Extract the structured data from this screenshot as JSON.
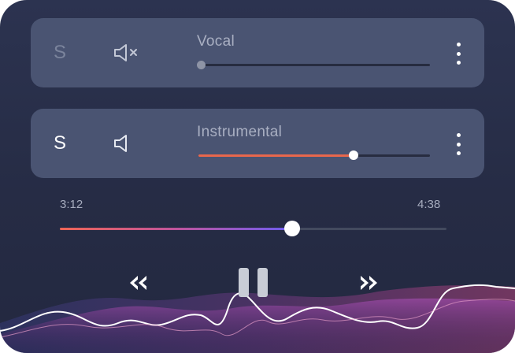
{
  "tracks": [
    {
      "solo_label": "S",
      "solo_active": false,
      "name": "Vocal",
      "muted": true,
      "speaker_icon": "speaker-muted-icon",
      "volume": 0.0
    },
    {
      "solo_label": "S",
      "solo_active": true,
      "name": "Instrumental",
      "muted": false,
      "speaker_icon": "speaker-icon",
      "volume": 0.67
    }
  ],
  "playback": {
    "current_time": "3:12",
    "total_time": "4:38",
    "progress": 0.6,
    "state": "playing"
  },
  "controls": {
    "rewind_icon": "rewind-icon",
    "pause_icon": "pause-icon",
    "fast_forward_icon": "fast-forward-icon",
    "more_icon": "more-vertical-icon"
  },
  "colors": {
    "background": "#262c45",
    "card": "#4a5472",
    "accent": "#e8674c",
    "progress_start": "#ef6556",
    "progress_end": "#6c5cf0"
  }
}
